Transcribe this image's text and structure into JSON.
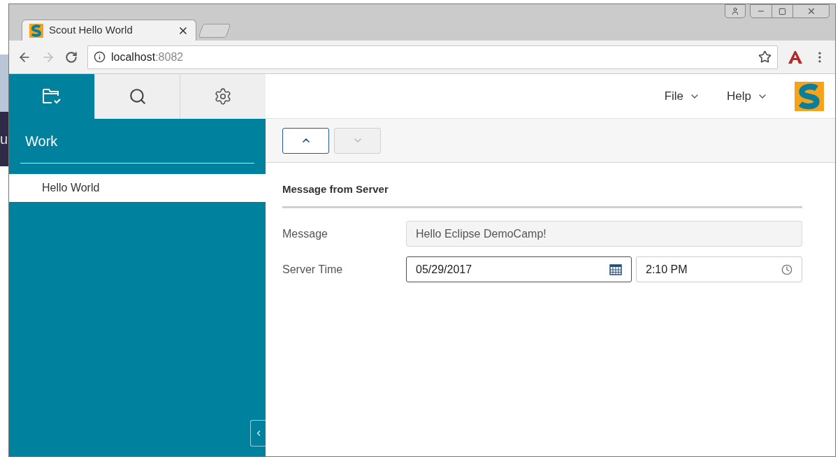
{
  "desktop_text": "u",
  "browser": {
    "tab": {
      "title": "Scout Hello World"
    },
    "url": {
      "host": "localhost",
      "port": ":8082"
    }
  },
  "sidebar": {
    "tabs": [
      {
        "kind": "folder",
        "selected": true
      },
      {
        "kind": "search",
        "selected": false
      },
      {
        "kind": "settings",
        "selected": false
      }
    ],
    "title": "Work",
    "items": [
      {
        "label": "Hello World",
        "selected": true
      }
    ]
  },
  "menu": [
    {
      "label": "File"
    },
    {
      "label": "Help"
    }
  ],
  "nav_buttons": [
    {
      "kind": "up",
      "disabled": false
    },
    {
      "kind": "down",
      "disabled": true
    }
  ],
  "group": {
    "title": "Message from Server"
  },
  "fields": [
    {
      "kind": "text",
      "label": "Message",
      "value": "Hello Eclipse DemoCamp!",
      "disabled": true
    },
    {
      "kind": "datetime",
      "label": "Server Time",
      "date": "05/29/2017",
      "time": "2:10 PM",
      "focused": true
    }
  ]
}
